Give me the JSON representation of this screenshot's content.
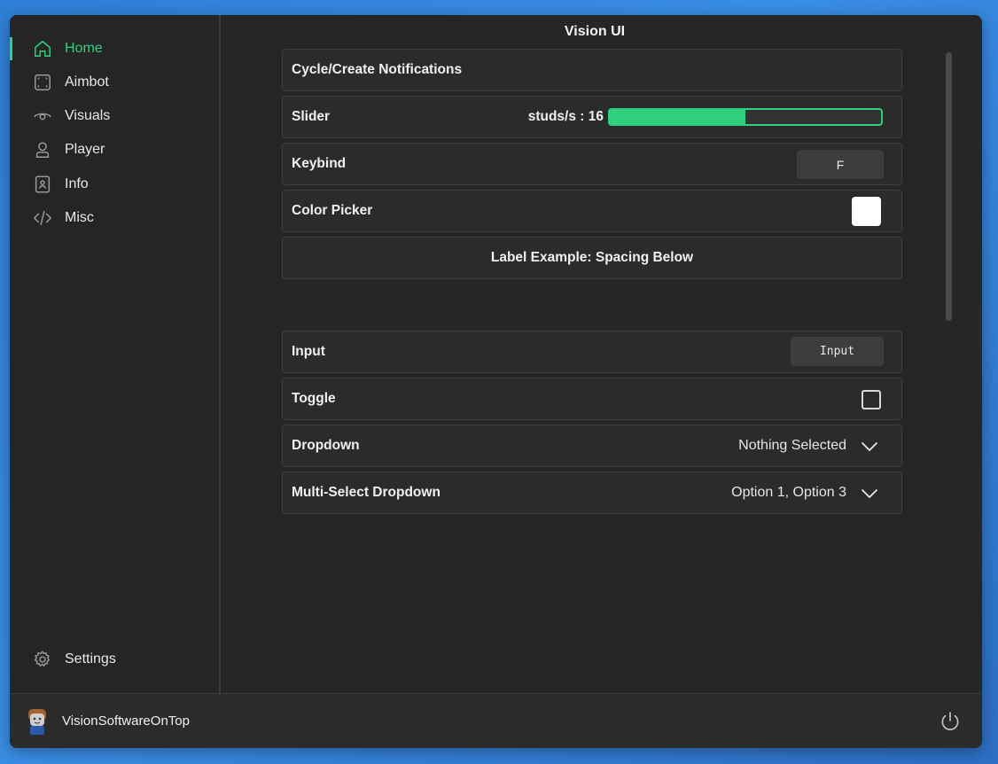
{
  "window": {
    "title": "Vision UI"
  },
  "sidebar": {
    "items": [
      {
        "label": "Home",
        "icon": "home-icon",
        "active": true
      },
      {
        "label": "Aimbot",
        "icon": "crosshair-frame-icon",
        "active": false
      },
      {
        "label": "Visuals",
        "icon": "eye-icon",
        "active": false
      },
      {
        "label": "Player",
        "icon": "user-icon",
        "active": false
      },
      {
        "label": "Info",
        "icon": "contact-card-icon",
        "active": false
      },
      {
        "label": "Misc",
        "icon": "code-icon",
        "active": false
      }
    ],
    "settings_label": "Settings"
  },
  "bottom": {
    "username": "VisionSoftwareOnTop"
  },
  "rows": {
    "notifications": "Cycle/Create Notifications",
    "slider": {
      "label": "Slider",
      "value_text": "studs/s : 16",
      "fill_fraction": 0.5
    },
    "keybind": {
      "label": "Keybind",
      "key": "F"
    },
    "color_picker": {
      "label": "Color Picker",
      "color": "#ffffff"
    },
    "label_example": "Label Example: Spacing Below",
    "input": {
      "label": "Input",
      "placeholder": "Input"
    },
    "toggle": {
      "label": "Toggle",
      "checked": false
    },
    "dropdown": {
      "label": "Dropdown",
      "value": "Nothing Selected"
    },
    "multi_dropdown": {
      "label": "Multi-Select Dropdown",
      "value": "Option 1, Option 3"
    }
  },
  "colors": {
    "accent": "#2fd17f",
    "background": "#262626",
    "row": "#2b2b2b"
  }
}
